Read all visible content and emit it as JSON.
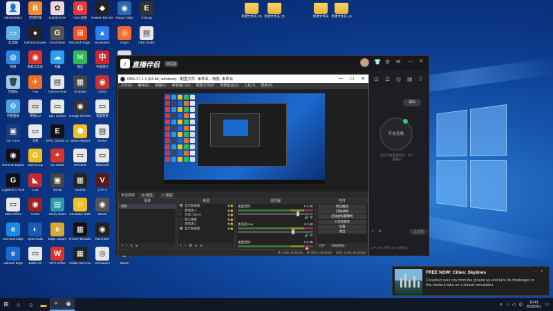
{
  "desktop": {
    "icons": [
      {
        "label": "Administrator",
        "color": "#e8e8e8",
        "glyph": "👤"
      },
      {
        "label": "哔哩哔哩",
        "color": "#f08a2c",
        "glyph": "B"
      },
      {
        "label": "Sub@Anime",
        "color": "#f3d4dc",
        "glyph": "✿"
      },
      {
        "label": "GGG加速",
        "color": "#e23a3a",
        "glyph": "G"
      },
      {
        "label": "Heaven Benchmark",
        "color": "#222",
        "glyph": "◆"
      },
      {
        "label": "Rogue Edge",
        "color": "#2a6ab0",
        "glyph": "◉"
      },
      {
        "label": "ExitLag",
        "color": "#333",
        "glyph": "E"
      },
      {
        "label": "此电脑",
        "color": "#5fb0e8",
        "glyph": "▭"
      },
      {
        "label": "GeForce Experience",
        "color": "#222",
        "glyph": "●"
      },
      {
        "label": "GoodGame",
        "color": "#555",
        "glyph": "G"
      },
      {
        "label": "Microsoft Edge 2022",
        "color": "#f25022",
        "glyph": "⊞"
      },
      {
        "label": "Bluestacks",
        "color": "#2d7ef0",
        "glyph": "▲"
      },
      {
        "label": "Origin",
        "color": "#f56c2d",
        "glyph": "◎"
      },
      {
        "label": "OBS Studio",
        "color": "#e8e8e8",
        "glyph": "▤"
      },
      {
        "label": "网络",
        "color": "#2b8ae0",
        "glyph": "◍"
      },
      {
        "label": "网易云音乐",
        "color": "#d8342b",
        "glyph": "◉"
      },
      {
        "label": "天翼",
        "color": "#2aa0f0",
        "glyph": "☁"
      },
      {
        "label": "微信",
        "color": "#2dbb55",
        "glyph": "✉"
      },
      {
        "label": "中国银行",
        "color": "#c8282b",
        "glyph": "中"
      },
      {
        "label": "Arduino",
        "color": "#ddd",
        "glyph": "▲"
      },
      {
        "label": "回收站",
        "color": "#9ac8e8",
        "glyph": "🗑"
      },
      {
        "label": "Aria",
        "color": "#f07020",
        "glyph": "✈"
      },
      {
        "label": "Geforce Now",
        "color": "#e8e8e8",
        "glyph": "▤"
      },
      {
        "label": "Snipaste",
        "color": "#444",
        "glyph": "▦"
      },
      {
        "label": "CSGO",
        "color": "#c83232",
        "glyph": "◉"
      },
      {
        "label": "控制面板",
        "color": "#4aa0e0",
        "glyph": "⚙"
      },
      {
        "label": "网易UU",
        "color": "#ddd",
        "glyph": "▭"
      },
      {
        "label": "Epic Games",
        "color": "#e8e8e8",
        "glyph": "▭"
      },
      {
        "label": "Google Chrome",
        "color": "#333",
        "glyph": "◉"
      },
      {
        "label": "电脑管家",
        "color": "#e8e8e8",
        "glyph": "▭"
      },
      {
        "label": "GE Force",
        "color": "#1a3a7a",
        "glyph": "▣"
      },
      {
        "label": "文档",
        "color": "#e8e8e8",
        "glyph": "▭"
      },
      {
        "label": "EPIC Games Launcher",
        "color": "#111",
        "glyph": "E"
      },
      {
        "label": "Steam Market",
        "color": "#f0c020",
        "glyph": "⬢"
      },
      {
        "label": "Sensor",
        "color": "#e8e8e8",
        "glyph": "▤"
      },
      {
        "label": "GeForce Experience",
        "color": "#111",
        "glyph": "◉"
      },
      {
        "label": "GameLoop",
        "color": "#f0c020",
        "glyph": "G"
      },
      {
        "label": "Go World",
        "color": "#d8342b",
        "glyph": "✦"
      },
      {
        "label": "WeGame",
        "color": "#e8e8e8",
        "glyph": "▭"
      },
      {
        "label": "Minecraft",
        "color": "#e8e8e8",
        "glyph": "▭"
      },
      {
        "label": "Logitech G HUB",
        "color": "#111",
        "glyph": "G"
      },
      {
        "label": "CUE",
        "color": "#c8282b",
        "glyph": "◣"
      },
      {
        "label": "Nvidia",
        "color": "#444",
        "glyph": "▣"
      },
      {
        "label": "Garena",
        "color": "#222",
        "glyph": "▦"
      },
      {
        "label": "GTA V",
        "color": "#5a1a1a",
        "glyph": "V"
      },
      {
        "label": "Mass Effect",
        "color": "#e8e8e8",
        "glyph": "▭"
      },
      {
        "label": "Cemu",
        "color": "#a02020",
        "glyph": "◉"
      },
      {
        "label": "Sticky Notes",
        "color": "#2a9aa8",
        "glyph": "▤"
      },
      {
        "label": "Geometry Dash",
        "color": "#f0c020",
        "glyph": "◇"
      },
      {
        "label": "Steam",
        "color": "#555",
        "glyph": "◉"
      },
      {
        "label": "Microsoft Edge",
        "color": "#1a8ae0",
        "glyph": "e"
      },
      {
        "label": "OpenAudio",
        "color": "#1a5ab0",
        "glyph": "◐"
      },
      {
        "label": "Edge Canary",
        "color": "#d8a830",
        "glyph": "e"
      },
      {
        "label": "NVIDIA Broadcast",
        "color": "#111",
        "glyph": "▦"
      },
      {
        "label": "Rainmeter",
        "color": "#222",
        "glyph": "◉"
      },
      {
        "label": "Valorant Edge",
        "color": "#1a6ad0",
        "glyph": "e"
      },
      {
        "label": "Battle.net",
        "color": "#e8e8e8",
        "glyph": "▭"
      },
      {
        "label": "WPS Office",
        "color": "#d8342b",
        "glyph": "W"
      },
      {
        "label": "Nvidia GeForce",
        "color": "#222",
        "glyph": "▦"
      },
      {
        "label": "Overwatch",
        "color": "#e8e8e8",
        "glyph": "◎"
      },
      {
        "label": "Steam",
        "color": "#1a3a6a",
        "glyph": "◉"
      },
      {
        "label": "Wargaming",
        "color": "#e8e8e8",
        "glyph": "▣"
      },
      {
        "label": "FairGame",
        "color": "#111",
        "glyph": "F"
      },
      {
        "label": "AirDroid Cast",
        "color": "#c83232",
        "glyph": "◉"
      },
      {
        "label": "Sourcetree",
        "color": "#1a6ad0",
        "glyph": "⑂"
      },
      {
        "label": "Wondery Sheet",
        "color": "#e8e8e8",
        "glyph": "▭"
      }
    ],
    "folders": [
      {
        "label": "新建文件夹 (2)"
      },
      {
        "label": "新建文件夹 (3)"
      },
      {
        "label": "新建文件夹"
      },
      {
        "label": "新建文件夹 (4)"
      }
    ]
  },
  "zhibo": {
    "app_name": "直播伴侣",
    "version": "测试版",
    "exit_label": "退出",
    "start_label": "开始直播",
    "hint": "点击开始直播按钮，进入直播间",
    "bottom_left": "美颜",
    "bottom_right": "设置",
    "bottom_box": "去直播",
    "stats": "CPU:6%   内存:22%   帧率:60"
  },
  "obs": {
    "title": "OBS 27.1.3 (64-bit, windows) - 配置文件: 未命名 - 场景: 未命名",
    "menu": [
      "文件(F)",
      "编辑(E)",
      "视图(V)",
      "停靠窗口(D)",
      "配置文件(P)",
      "场景集合(S)",
      "工具(T)",
      "帮助(H)"
    ],
    "footer_left": "未选择源",
    "footer_props": "属性",
    "footer_filters": "滤镜",
    "docks": {
      "scenes": {
        "title": "场景",
        "items": [
          "场景"
        ]
      },
      "sources": {
        "title": "来源",
        "items": [
          {
            "glyph": "🖥",
            "label": "显示器采集"
          },
          {
            "glyph": "▭",
            "label": "游戏源 3"
          },
          {
            "glyph": "T",
            "label": "文本 (GDI+)"
          },
          {
            "glyph": "▭",
            "label": "窗口采集"
          },
          {
            "glyph": "▭",
            "label": "游戏源 2"
          },
          {
            "glyph": "🖥",
            "label": "显示器采集"
          }
        ]
      },
      "mixer": {
        "title": "混音器",
        "channels": [
          {
            "name": "桌面音频",
            "db": "0.0 dB",
            "level": 0.78
          },
          {
            "name": "麦克风/Aux",
            "db": "0.0 dB",
            "level": 0.72
          },
          {
            "name": "桌面音频",
            "db": "0.0 dB",
            "level": 0.9
          }
        ]
      },
      "controls": {
        "title": "控件",
        "buttons": [
          "停止推流",
          "开始录制",
          "启动虚拟摄像机",
          "工作室模式",
          "设置",
          "退出"
        ],
        "tabs": [
          "控件",
          "转场特效"
        ]
      }
    },
    "status": {
      "live": "LIVE: 00:00:00",
      "rec": "REC: 00:00:00",
      "cpu": "CPU: 2.0%, 60.00 fps"
    }
  },
  "notification": {
    "title": "FREE NOW: Cities: Skylines",
    "body": "Construct your city from the ground up and face its challenges in this modern take on a classic simulation.",
    "close": "×",
    "more": "···"
  },
  "taskbar": {
    "time": "10:41",
    "date": "2022/3/11",
    "lang": "中"
  }
}
